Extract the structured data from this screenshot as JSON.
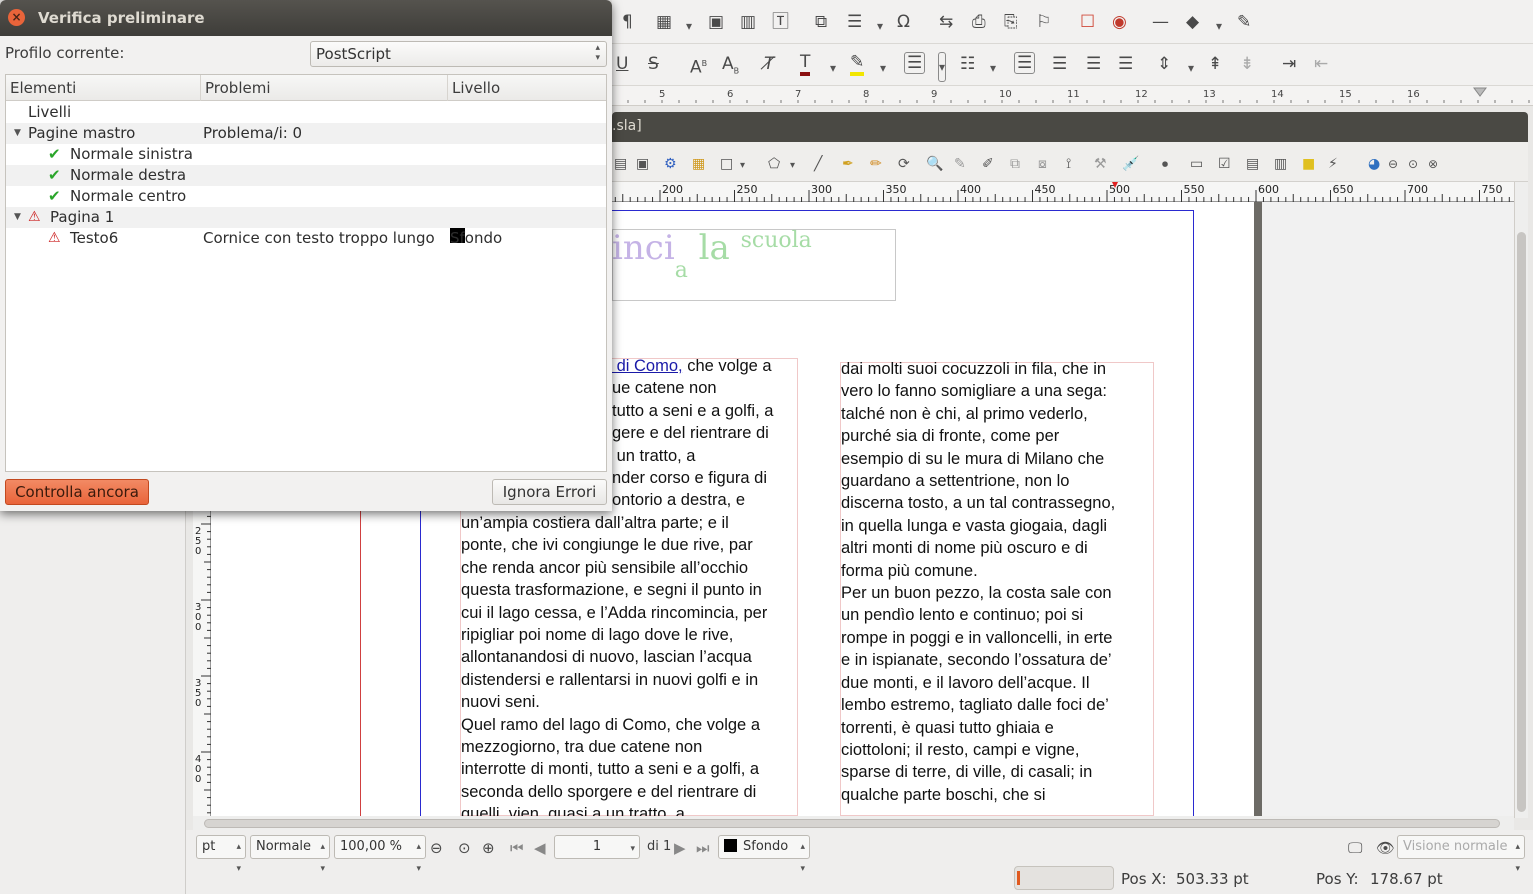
{
  "dialog": {
    "title": "Verifica preliminare",
    "profile_label": "Profilo corrente:",
    "profile_value": "PostScript",
    "columns": [
      "Elementi",
      "Problemi",
      "Livello"
    ],
    "rows": [
      {
        "label": "Livelli",
        "problem": "",
        "level": ""
      },
      {
        "label": "Pagine mastro",
        "problem": "Problema/i: 0",
        "level": ""
      },
      {
        "label": "Normale sinistra",
        "problem": "",
        "level": ""
      },
      {
        "label": "Normale destra",
        "problem": "",
        "level": ""
      },
      {
        "label": "Normale centro",
        "problem": "",
        "level": ""
      },
      {
        "label": "Pagina 1",
        "problem": "",
        "level": ""
      },
      {
        "label": "Testo6",
        "problem": "Cornice con testo troppo lungo",
        "level": "Sfondo"
      }
    ],
    "recheck_label": "Controlla ancora",
    "ignore_label": "Ignora Errori"
  },
  "document": {
    "tab_title": ".sla]",
    "title_parts": [
      "inci",
      "a",
      "la",
      "scuola"
    ],
    "col1_top_link": " di Como,",
    "col1_top_rest": " che volge a",
    "col1_top_lines": [
      "ue catene non",
      "tutto a seni e a golfi, a",
      "gere e del rientrare di",
      " un tratto, a",
      "nder corso e figura di",
      "ontorio a destra, e"
    ],
    "col1_lines": [
      "un’ampia costiera dall’altra parte; e il",
      "ponte, che ivi congiunge le due rive, par",
      "che renda ancor più sensibile all’occhio",
      "questa trasformazione, e segni il punto in",
      "cui il lago cessa, e l’Adda rincomincia, per",
      "ripigliar poi nome di lago dove le rive,",
      "allontanandosi di nuovo, lascian l’acqua",
      "distendersi e rallentarsi in nuovi golfi e in",
      "nuovi seni.",
      "Quel ramo del lago di Como, che volge a",
      "mezzogiorno, tra due catene non",
      "interrotte di monti, tutto a seni e a golfi, a",
      "seconda dello sporgere e del rientrare di",
      "quelli, vien, quasi a un tratto, a"
    ],
    "col2_lines": [
      "dai molti suoi cocuzzoli in fila, che in",
      "vero lo fanno somigliare a una sega:",
      "talché non è chi, al primo vederlo,",
      "purché sia di fronte, come per",
      "esempio di su le mura di Milano che",
      "guardano a settentrione, non lo",
      "discerna tosto, a un tal contrassegno,",
      "in quella lunga e vasta giogaia, dagli",
      "altri monti di nome più oscuro e di",
      "forma più comune.",
      "Per un buon pezzo, la costa sale con",
      "un pendìo lento e continuo; poi si",
      "rompe in poggi e in valloncelli, in erte",
      "e in ispianate, secondo l’ossatura de’",
      "due monti, e il lavoro dell’acque. Il",
      "lembo estremo, tagliato dalle foci de’",
      "torrenti, è quasi tutto ghiaia e",
      "ciottoloni; il resto, campi e vigne,",
      "sparse di terre, di ville, di casali; in",
      "qualche parte boschi, che si",
      "         "
    ]
  },
  "rulers": {
    "h_ticks": [
      "200",
      "250",
      "300",
      "350",
      "400",
      "450",
      "500",
      "550",
      "600",
      "650",
      "700",
      "750"
    ],
    "para_ticks": [
      "5",
      "6",
      "7",
      "8",
      "9",
      "10",
      "11",
      "12",
      "13",
      "14",
      "15",
      "16"
    ],
    "v_ticks": [
      "250",
      "300",
      "350",
      "400"
    ]
  },
  "statusbar": {
    "unit": "pt",
    "mode": "Normale",
    "zoom": "100,00 %",
    "page": "1",
    "page_of": "di 1",
    "layer": "Sfondo",
    "view": "Visione normale",
    "pos_x_label": "Pos X:",
    "pos_x_value": "503.33 pt",
    "pos_y_label": "Pos Y:",
    "pos_y_value": "178.67 pt"
  },
  "colors": {
    "accent": "#e9643a",
    "titlebar": "#3e3d39",
    "check": "#2aa52a",
    "warning": "#cc2222",
    "guide": "#2a2ad0"
  }
}
